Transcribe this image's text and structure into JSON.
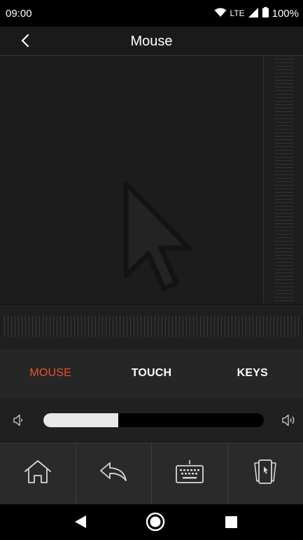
{
  "status_bar": {
    "time": "09:00",
    "network": "LTE",
    "battery": "100%"
  },
  "header": {
    "title": "Mouse",
    "back_icon": "chevron-left-icon"
  },
  "touchpad": {
    "icon": "mouse-pointer-icon"
  },
  "tabs": [
    {
      "label": "MOUSE",
      "active": true
    },
    {
      "label": "TOUCH",
      "active": false
    },
    {
      "label": "KEYS",
      "active": false
    }
  ],
  "volume": {
    "level_fraction": 0.34,
    "low_icon": "volume-low-icon",
    "high_icon": "volume-high-icon"
  },
  "toolbar": [
    {
      "icon": "home-icon"
    },
    {
      "icon": "return-icon"
    },
    {
      "icon": "keyboard-icon"
    },
    {
      "icon": "device-cursor-icon"
    }
  ],
  "colors": {
    "accent": "#e6522a",
    "background": "#1c1c1c"
  }
}
